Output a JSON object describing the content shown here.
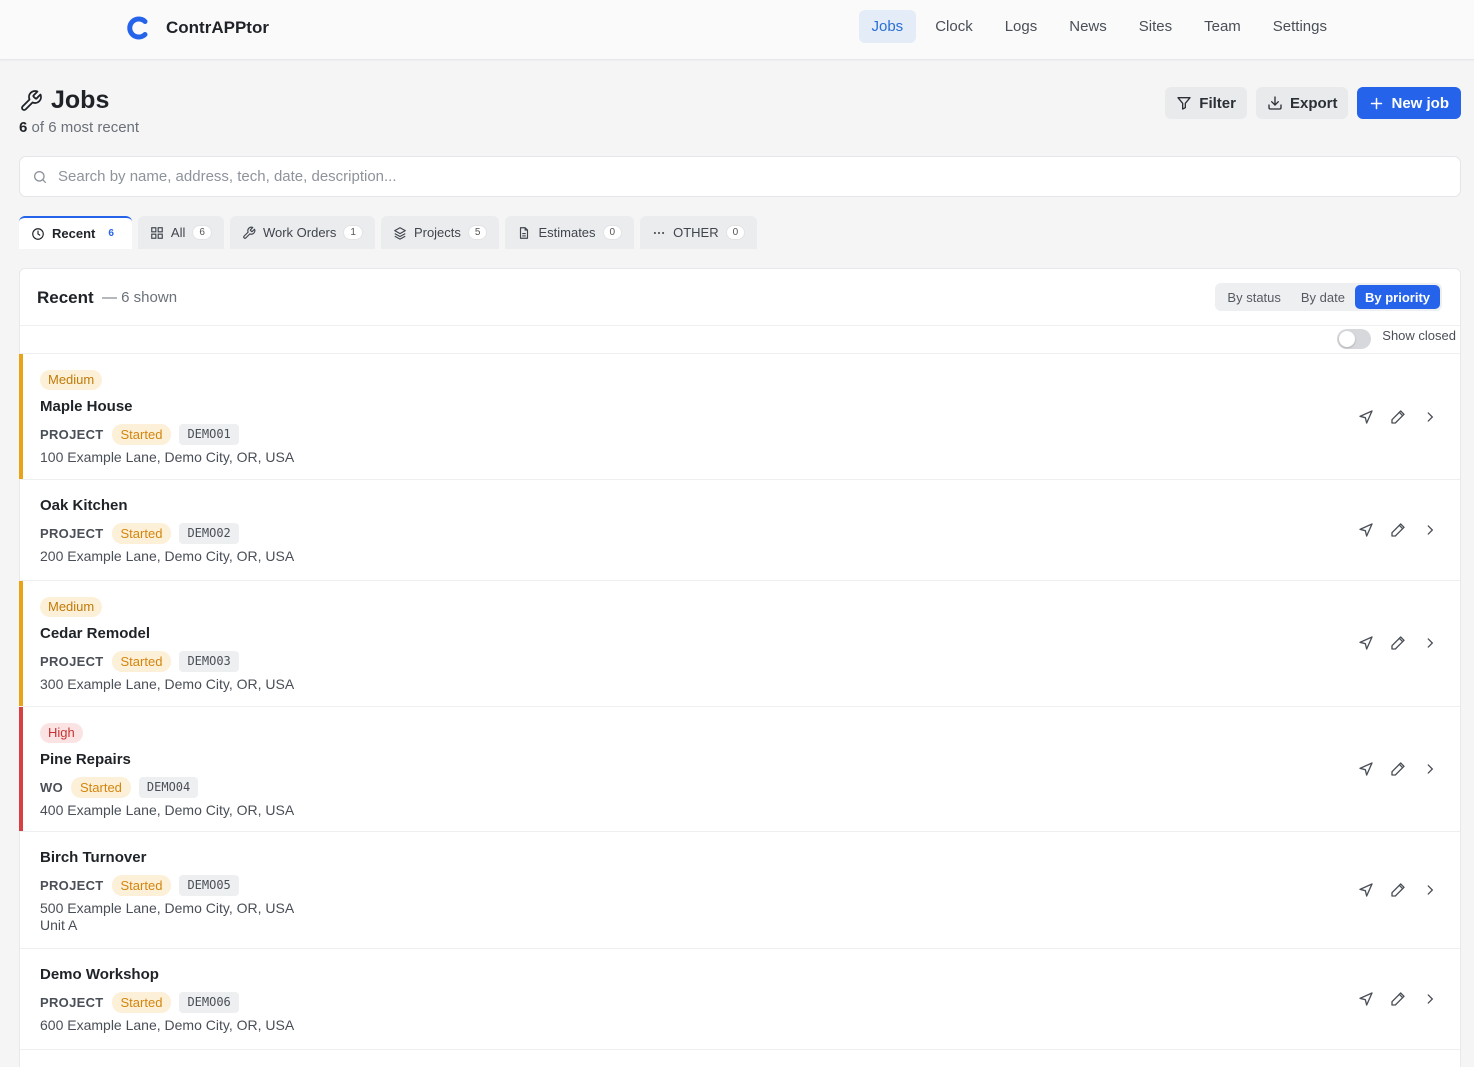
{
  "app": {
    "name": "ContrAPPtor",
    "brand_color": "#2563eb"
  },
  "nav": {
    "items": [
      {
        "label": "Jobs",
        "active": true
      },
      {
        "label": "Clock"
      },
      {
        "label": "Logs"
      },
      {
        "label": "News"
      },
      {
        "label": "Sites"
      },
      {
        "label": "Team"
      },
      {
        "label": "Settings"
      }
    ]
  },
  "header": {
    "title": "Jobs",
    "shown_count": "6",
    "subtitle_rest": " of 6 most recent",
    "filter_label": "Filter",
    "export_label": "Export",
    "new_job_label": "New job"
  },
  "search": {
    "placeholder": "Search by name, address, tech, date, description..."
  },
  "tabs": [
    {
      "label": "Recent",
      "count": "6",
      "icon": "clock-icon",
      "active": true
    },
    {
      "label": "All",
      "count": "6",
      "icon": "grid-icon"
    },
    {
      "label": "Work Orders",
      "count": "1",
      "icon": "wrench-icon"
    },
    {
      "label": "Projects",
      "count": "5",
      "icon": "layers-icon"
    },
    {
      "label": "Estimates",
      "count": "0",
      "icon": "document-icon"
    },
    {
      "label": "OTHER",
      "count": "0",
      "icon": "more-icon"
    }
  ],
  "panel": {
    "title": "Recent",
    "count_text": "— 6 shown",
    "sort_options": [
      "By status",
      "By date",
      "By priority"
    ],
    "sort_active": "By priority",
    "show_closed_label": "Show closed",
    "show_closed": false
  },
  "jobs": [
    {
      "priority": "Medium",
      "name": "Maple House",
      "type": "PROJECT",
      "status": "Started",
      "code": "DEMO01",
      "address": "100 Example Lane, Demo City, OR, USA",
      "address2": ""
    },
    {
      "priority": "",
      "name": "Oak Kitchen",
      "type": "PROJECT",
      "status": "Started",
      "code": "DEMO02",
      "address": "200 Example Lane, Demo City, OR, USA",
      "address2": ""
    },
    {
      "priority": "Medium",
      "name": "Cedar Remodel",
      "type": "PROJECT",
      "status": "Started",
      "code": "DEMO03",
      "address": "300 Example Lane, Demo City, OR, USA",
      "address2": ""
    },
    {
      "priority": "High",
      "name": "Pine Repairs",
      "type": "WO",
      "status": "Started",
      "code": "DEMO04",
      "address": "400 Example Lane, Demo City, OR, USA",
      "address2": ""
    },
    {
      "priority": "",
      "name": "Birch Turnover",
      "type": "PROJECT",
      "status": "Started",
      "code": "DEMO05",
      "address": "500 Example Lane, Demo City, OR, USA",
      "address2": "Unit A"
    },
    {
      "priority": "",
      "name": "Demo Workshop",
      "type": "PROJECT",
      "status": "Started",
      "code": "DEMO06",
      "address": "600 Example Lane, Demo City, OR, USA",
      "address2": ""
    }
  ],
  "colors": {
    "priority_medium": "#e8a317",
    "priority_high": "#d64040",
    "accent": "#2563eb"
  }
}
